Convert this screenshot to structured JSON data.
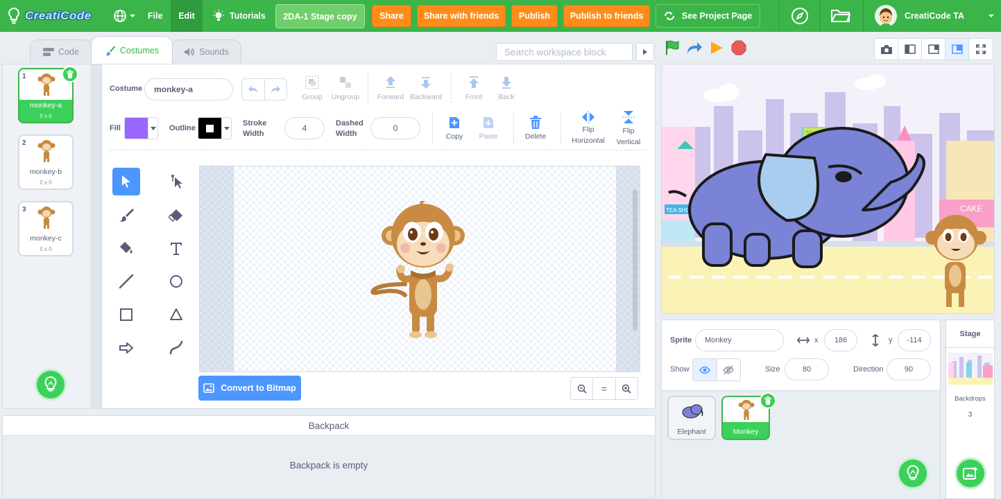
{
  "app": {
    "logo_text": "CreatiCode",
    "brand_color": "#3bb54a",
    "accent_color": "#ff8c1a"
  },
  "menubar": {
    "file": "File",
    "edit": "Edit",
    "tutorials": "Tutorials",
    "project_title": "2DA-1 Stage copy",
    "share": "Share",
    "share_friends": "Share with friends",
    "publish": "Publish",
    "publish_friends": "Publish to friends",
    "see_project": "See Project Page",
    "username": "CreatiCode TA"
  },
  "tabs": {
    "code": "Code",
    "costumes": "Costumes",
    "sounds": "Sounds"
  },
  "search": {
    "placeholder": "Search workspace block"
  },
  "costumes": [
    {
      "num": "1",
      "name": "monkey-a",
      "size": "0 x 0",
      "selected": true
    },
    {
      "num": "2",
      "name": "monkey-b",
      "size": "0 x 0",
      "selected": false
    },
    {
      "num": "3",
      "name": "monkey-c",
      "size": "0 x 0",
      "selected": false
    }
  ],
  "editor": {
    "costume_label": "Costume",
    "costume_name": "monkey-a",
    "group": "Group",
    "ungroup": "Ungroup",
    "forward": "Forward",
    "backward": "Backward",
    "front": "Front",
    "back": "Back",
    "fill_label": "Fill",
    "fill_color": "#9966ff",
    "outline_label": "Outline",
    "outline_color": "#000000",
    "stroke_width_label1": "Stroke",
    "stroke_width_label2": "Width",
    "stroke_width": "4",
    "dashed_label1": "Dashed",
    "dashed_label2": "Width",
    "dashed_width": "0",
    "copy": "Copy",
    "paste": "Paste",
    "delete": "Delete",
    "flip_h1": "Flip",
    "flip_h2": "Horizontal",
    "flip_v1": "Flip",
    "flip_v2": "Vertical",
    "convert": "Convert to Bitmap",
    "zoom_reset": "="
  },
  "backpack": {
    "title": "Backpack",
    "empty": "Backpack is empty"
  },
  "sprite_info": {
    "sprite_label": "Sprite",
    "sprite_name": "Monkey",
    "x_label": "x",
    "x": "186",
    "y_label": "y",
    "y": "-114",
    "show_label": "Show",
    "size_label": "Size",
    "size": "80",
    "direction_label": "Direction",
    "direction": "90"
  },
  "sprites": [
    {
      "name": "Elephant",
      "selected": false
    },
    {
      "name": "Monkey",
      "selected": true
    }
  ],
  "stage_panel": {
    "title": "Stage",
    "backdrops_label": "Backdrops",
    "backdrops_count": "3"
  },
  "stage_scene": {
    "tea_shop": "TEA SHOP",
    "cake": "CAKE",
    "scroll_sign": "Scro"
  }
}
